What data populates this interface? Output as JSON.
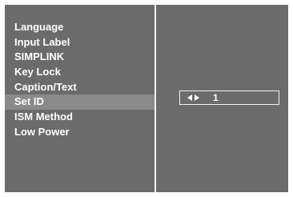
{
  "menu": {
    "items": [
      {
        "label": "Language"
      },
      {
        "label": "Input Label"
      },
      {
        "label": "SIMPLINK"
      },
      {
        "label": "Key Lock"
      },
      {
        "label": "Caption/Text"
      },
      {
        "label": "Set ID",
        "selected": true
      },
      {
        "label": "ISM Method"
      },
      {
        "label": "Low Power"
      }
    ]
  },
  "detail": {
    "value": "1",
    "icons": [
      "arrow-left-icon",
      "arrow-right-icon"
    ]
  },
  "colors": {
    "panel_bg": "#6b6b6b",
    "selected_bg": "#8a8a8a",
    "text": "#ffffff",
    "divider": "#f2f2f2",
    "outer_bg": "#ffffff"
  }
}
